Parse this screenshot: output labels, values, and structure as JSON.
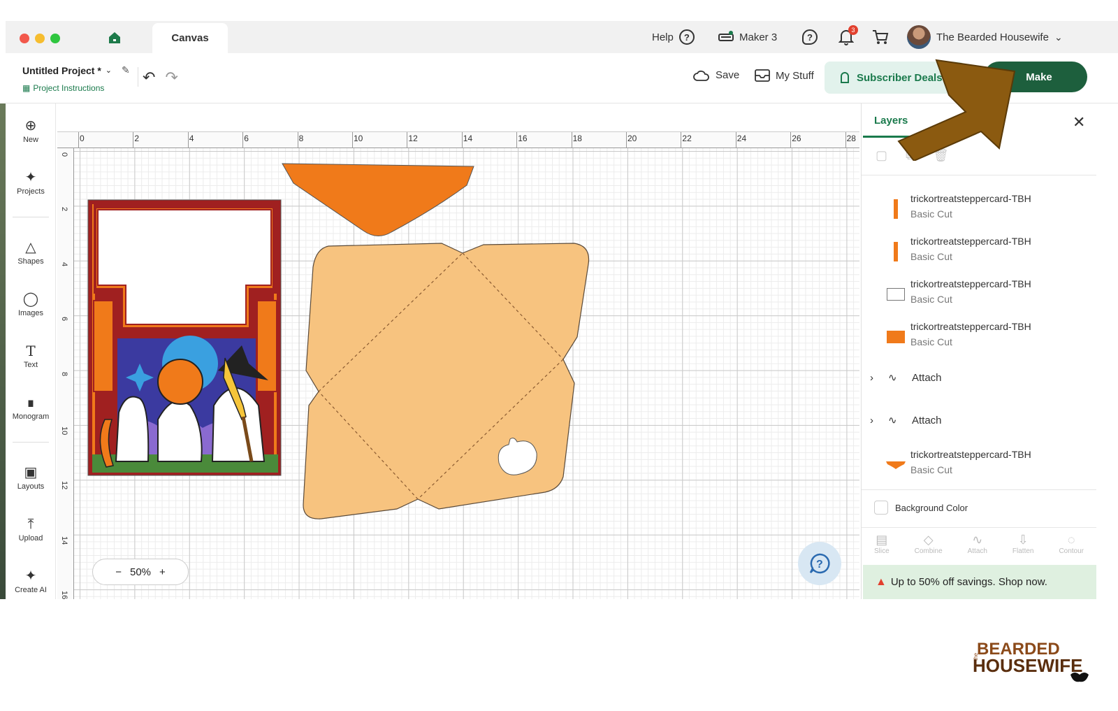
{
  "window": {
    "tab_title": "Canvas"
  },
  "topbar": {
    "help_label": "Help",
    "machine_label": "Maker 3",
    "notification_count": "3",
    "user_name": "The Bearded Housewife"
  },
  "toolbar": {
    "project_title": "Untitled Project *",
    "project_instructions": "Project Instructions",
    "save_label": "Save",
    "mystuff_label": "My Stuff",
    "subscriber_deals_label": "Subscriber Deals",
    "make_label": "Make"
  },
  "sidebar": {
    "items": [
      {
        "label": "New",
        "icon": "plus-circle-icon"
      },
      {
        "label": "Projects",
        "icon": "rocket-icon"
      },
      {
        "label": "Shapes",
        "icon": "shapes-icon"
      },
      {
        "label": "Images",
        "icon": "lightbulb-icon"
      },
      {
        "label": "Text",
        "icon": "text-icon"
      },
      {
        "label": "Monogram",
        "icon": "monogram-icon"
      },
      {
        "label": "Layouts",
        "icon": "shirt-icon"
      },
      {
        "label": "Upload",
        "icon": "upload-icon"
      },
      {
        "label": "Create AI",
        "icon": "sparkle-icon"
      }
    ]
  },
  "ruler": {
    "h_labels": [
      "0",
      "2",
      "4",
      "6",
      "8",
      "10",
      "12",
      "14",
      "16",
      "18",
      "20",
      "22",
      "24",
      "26",
      "28"
    ],
    "v_labels": [
      "0",
      "2",
      "4",
      "6",
      "8",
      "10",
      "12",
      "14",
      "16"
    ]
  },
  "zoom": {
    "minus": "−",
    "value": "50%",
    "plus": "+"
  },
  "layers_panel": {
    "tab_label": "Layers",
    "layers": [
      {
        "name": "trickortreatsteppercard-TBH",
        "operation": "Basic Cut",
        "color": "#f07a1a",
        "shape": "bar"
      },
      {
        "name": "trickortreatsteppercard-TBH",
        "operation": "Basic Cut",
        "color": "#f07a1a",
        "shape": "bar"
      },
      {
        "name": "trickortreatsteppercard-TBH",
        "operation": "Basic Cut",
        "color": "#ffffff",
        "shape": "frame"
      },
      {
        "name": "trickortreatsteppercard-TBH",
        "operation": "Basic Cut",
        "color": "#f07a1a",
        "shape": "block"
      }
    ],
    "attach_groups": [
      {
        "label": "Attach"
      },
      {
        "label": "Attach"
      }
    ],
    "last_layer": {
      "name": "trickortreatsteppercard-TBH",
      "operation": "Basic Cut",
      "color": "#f07a1a"
    },
    "background_color_label": "Background Color",
    "bottom_tools": [
      "Slice",
      "Combine",
      "Attach",
      "Flatten",
      "Contour"
    ],
    "promo_text": "Up to 50% off savings. Shop now."
  },
  "brand_logo": {
    "small": "the",
    "line1": "BEARDED",
    "line2": "HOUSEWIFE"
  },
  "colors": {
    "accent_green": "#1a7a4c",
    "make_button": "#1d5f3d",
    "envelope_orange": "#f07a1a",
    "envelope_peach": "#f7c37f",
    "arrow_brown": "#8b5a10"
  }
}
